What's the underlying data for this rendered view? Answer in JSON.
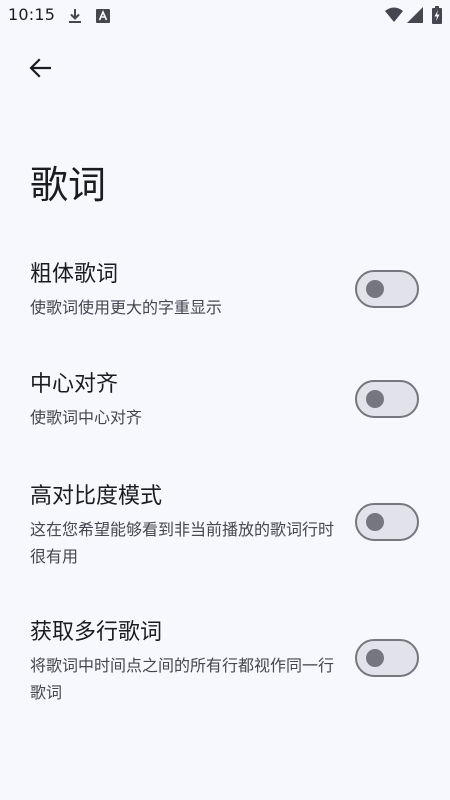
{
  "status_bar": {
    "time": "10:15",
    "icons": [
      "download-icon",
      "app-icon",
      "wifi-icon",
      "signal-icon",
      "battery-icon"
    ]
  },
  "header": {
    "back_icon": "arrow-back-icon",
    "title": "歌词"
  },
  "settings": [
    {
      "title": "粗体歌词",
      "description": "使歌词使用更大的字重显示",
      "enabled": false
    },
    {
      "title": "中心对齐",
      "description": "使歌词中心对齐",
      "enabled": false
    },
    {
      "title": "高对比度模式",
      "description": "这在您希望能够看到非当前播放的歌词行时很有用",
      "enabled": false
    },
    {
      "title": "获取多行歌词",
      "description": "将歌词中时间点之间的所有行都视作同一行歌词",
      "enabled": false
    }
  ],
  "colors": {
    "background": "#f7f8fe",
    "toggle_track_off": "#e1e2ea",
    "toggle_outline_off": "#75767f"
  }
}
